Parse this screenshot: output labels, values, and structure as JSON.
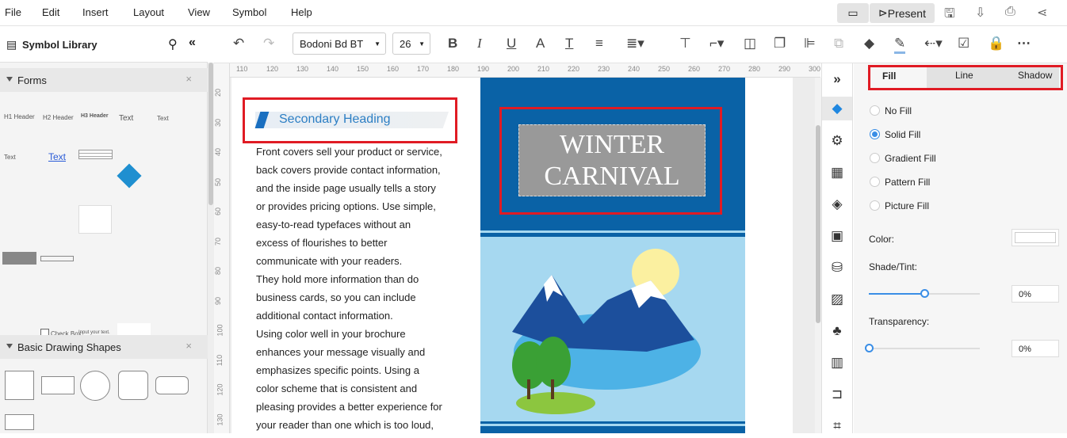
{
  "menu": [
    "File",
    "Edit",
    "Insert",
    "Layout",
    "View",
    "Symbol",
    "Help"
  ],
  "top_actions": {
    "present_label": "Present"
  },
  "sidebar": {
    "title": "Symbol Library",
    "sections": [
      {
        "label": "Forms"
      },
      {
        "label": "Basic Drawing Shapes"
      }
    ],
    "forms_symbols": [
      "H1 Header",
      "H2 Header",
      "H3 Header",
      "Text",
      "Text",
      "Text",
      "Text",
      "Check Box",
      "Input your text."
    ]
  },
  "toolbar": {
    "font": "Bodoni Bd BT",
    "size": "26"
  },
  "ruler": {
    "h": [
      "110",
      "120",
      "130",
      "140",
      "150",
      "160",
      "170",
      "180",
      "190",
      "200",
      "210",
      "220",
      "230",
      "240",
      "250",
      "260",
      "270",
      "280",
      "290",
      "300"
    ],
    "v": [
      "20",
      "30",
      "40",
      "50",
      "60",
      "70",
      "80",
      "90",
      "100",
      "110",
      "120",
      "130"
    ]
  },
  "doc": {
    "heading": "Secondary Heading",
    "body": [
      "Front covers sell your product or service,",
      "back covers provide contact information,",
      "and the inside page usually tells a story",
      "or provides pricing options. Use simple,",
      "easy-to-read typefaces without an",
      "excess of flourishes to better",
      "communicate with your readers.",
      "They hold more information than do",
      "business cards, so you can include",
      "additional contact information.",
      "Using color well in your brochure",
      "enhances your message visually and",
      "emphasizes specific points. Using a",
      "color scheme that is consistent and",
      "pleasing provides a better experience for",
      "your reader than one which is too loud,"
    ],
    "title_lines": [
      "WINTER",
      "CARNIVAL"
    ]
  },
  "panel": {
    "tabs": [
      {
        "label": "Fill",
        "active": true
      },
      {
        "label": "Line"
      },
      {
        "label": "Shadow"
      }
    ],
    "fill_options": [
      {
        "label": "No Fill"
      },
      {
        "label": "Solid Fill",
        "selected": true
      },
      {
        "label": "Gradient Fill"
      },
      {
        "label": "Pattern Fill"
      },
      {
        "label": "Picture Fill"
      }
    ],
    "color_label": "Color:",
    "color_value": "#ffffff",
    "shade_label": "Shade/Tint:",
    "shade_value": "0%",
    "shade_level": 0.5,
    "transparency_label": "Transparency:",
    "transparency_value": "0%",
    "transparency_level": 0
  },
  "colors": {
    "accent": "#3a8ee6",
    "highlight": "#e01b24",
    "brochure_blue": "#0a62a6",
    "sky": "#a6d8f0"
  }
}
